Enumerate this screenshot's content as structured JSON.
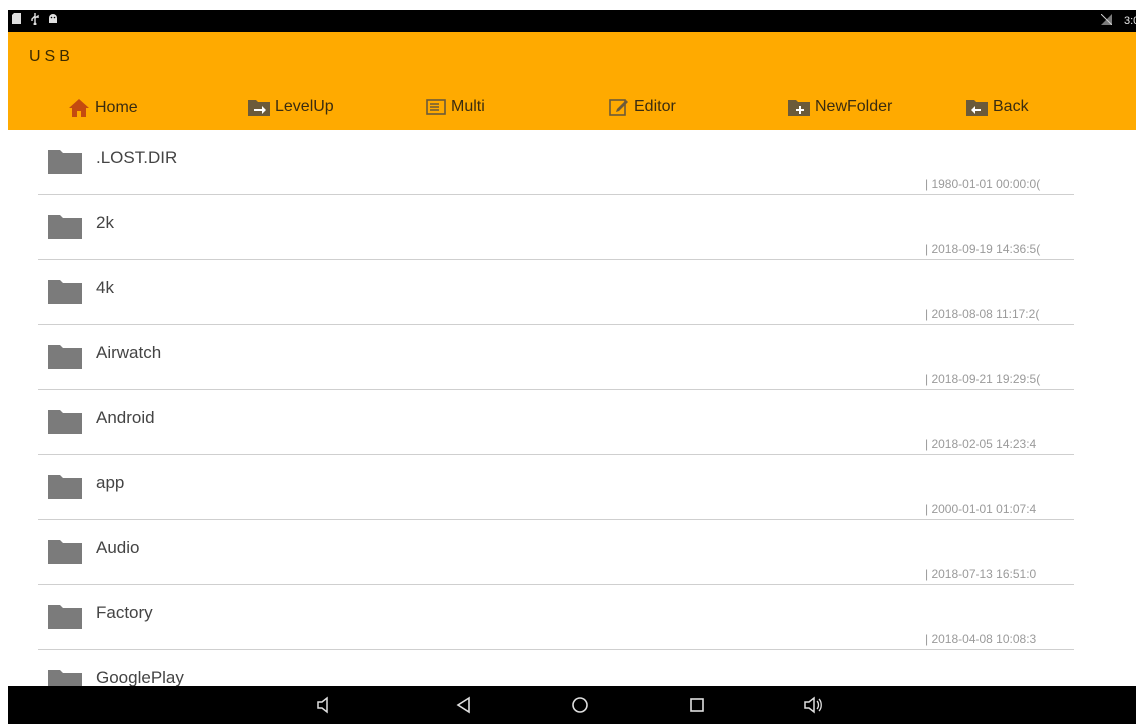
{
  "status_bar": {
    "left_icons": [
      "sd-card-icon",
      "usb-icon",
      "android-icon"
    ],
    "right_icons": [
      "no-signal-icon"
    ],
    "time": "3:0"
  },
  "header": {
    "title": "USB",
    "accent_color": "#ffaa00"
  },
  "toolbar": {
    "items": [
      {
        "label": "Home",
        "icon": "home-icon"
      },
      {
        "label": "LevelUp",
        "icon": "levelup-icon"
      },
      {
        "label": "Multi",
        "icon": "multi-select-icon"
      },
      {
        "label": "Editor",
        "icon": "editor-icon"
      },
      {
        "label": "NewFolder",
        "icon": "new-folder-icon"
      },
      {
        "label": "Back",
        "icon": "back-icon"
      }
    ]
  },
  "files": [
    {
      "name": ".LOST.DIR",
      "date": "| 1980-01-01 00:00:0("
    },
    {
      "name": "2k",
      "date": "| 2018-09-19 14:36:5("
    },
    {
      "name": "4k",
      "date": "| 2018-08-08 11:17:2("
    },
    {
      "name": "Airwatch",
      "date": "| 2018-09-21 19:29:5("
    },
    {
      "name": "Android",
      "date": "| 2018-02-05 14:23:4"
    },
    {
      "name": "app",
      "date": "| 2000-01-01 01:07:4"
    },
    {
      "name": "Audio",
      "date": "| 2018-07-13 16:51:0"
    },
    {
      "name": "Factory",
      "date": "| 2018-04-08 10:08:3"
    },
    {
      "name": "GooglePlay",
      "date": ""
    }
  ],
  "nav_bar": {
    "buttons": [
      "volume-down-icon",
      "back-triangle-icon",
      "home-circle-icon",
      "recents-square-icon",
      "volume-up-icon"
    ]
  }
}
